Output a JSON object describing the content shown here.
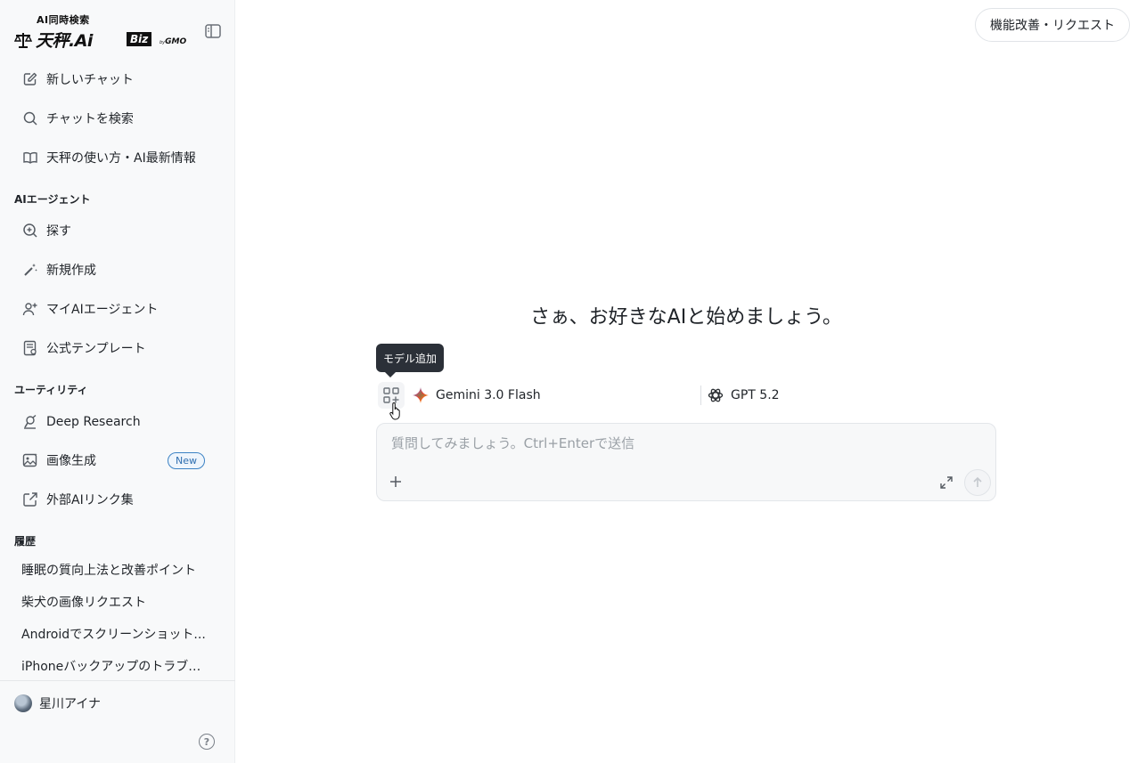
{
  "brand": {
    "tagline": "AI同時検索",
    "name": "天秤.Ai",
    "edition": "Biz",
    "by": "by",
    "maker": "GMO"
  },
  "sidebar": {
    "top_items": [
      {
        "label": "新しいチャット",
        "icon": "edit-icon"
      },
      {
        "label": "チャットを検索",
        "icon": "search-icon"
      },
      {
        "label": "天秤の使い方・AI最新情報",
        "icon": "book-icon"
      }
    ],
    "agents_section": "AIエージェント",
    "agent_items": [
      {
        "label": "探す",
        "icon": "zoom-plus-icon"
      },
      {
        "label": "新規作成",
        "icon": "wand-icon"
      },
      {
        "label": "マイAIエージェント",
        "icon": "user-plus-icon"
      },
      {
        "label": "公式テンプレート",
        "icon": "template-icon"
      }
    ],
    "utility_section": "ユーティリティ",
    "utility_items": [
      {
        "label": "Deep Research",
        "icon": "research-icon"
      },
      {
        "label": "画像生成",
        "icon": "image-icon",
        "badge": "New"
      },
      {
        "label": "外部AIリンク集",
        "icon": "external-link-icon"
      }
    ],
    "history_section": "履歴",
    "history_items": [
      "睡眠の質向上法と改善ポイント",
      "柴犬の画像リクエスト",
      "Androidでスクリーンショット...",
      "iPhoneバックアップのトラブル..."
    ],
    "user_name": "星川アイナ",
    "help_symbol": "?"
  },
  "header": {
    "feedback_label": "機能改善・リクエスト"
  },
  "main": {
    "headline": "さぁ、お好きなAIと始めましょう。",
    "add_model_tooltip": "モデル追加",
    "models": [
      {
        "name": "Gemini 3.0 Flash",
        "icon": "gemini-icon"
      },
      {
        "name": "GPT 5.2",
        "icon": "openai-icon"
      }
    ],
    "composer": {
      "placeholder": "質問してみましょう。Ctrl+Enterで送信",
      "value": ""
    }
  },
  "colors": {
    "sidebar_bg": "#f8f9fa",
    "badge_blue": "#3b82c4",
    "tooltip_bg": "#2b3038"
  }
}
